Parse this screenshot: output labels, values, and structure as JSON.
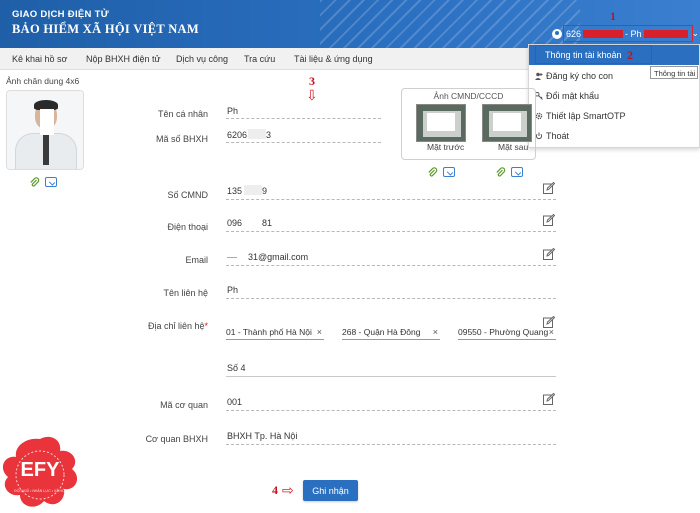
{
  "header": {
    "brand_top": "GIAO DỊCH ĐIỆN TỬ",
    "brand_main": "BẢO HIỂM XÃ HỘI VIỆT NAM",
    "user_prefix": "626",
    "user_suffix": "- Ph",
    "chevron": "⌄"
  },
  "annotations": {
    "step1": "1",
    "step2": "2",
    "step3": "⇩",
    "step3_num": "3",
    "step4": "4",
    "step4_arrow": "⇨"
  },
  "nav": {
    "items": [
      "Kê khai hồ sơ",
      "Nộp BHXH điện tử",
      "Dịch vụ công",
      "Tra cứu",
      "Tài liệu & ứng dụng"
    ]
  },
  "dropdown": {
    "active": "Thông tin tài khoản",
    "items": [
      {
        "label": "Đăng ký cho con",
        "icon": "user-add-icon"
      },
      {
        "label": "Đổi mật khẩu",
        "icon": "key-icon"
      },
      {
        "label": "Thiết lập SmartOTP",
        "icon": "gear-icon"
      },
      {
        "label": "Thoát",
        "icon": "power-icon"
      }
    ],
    "tooltip": "Thông tin tài"
  },
  "photo": {
    "label": "Ảnh chân dung 4x6"
  },
  "cmnd": {
    "title": "Ảnh CMND/CCCD",
    "front": "Mặt trước",
    "back": "Mặt sau"
  },
  "form": {
    "ten_ca_nhan": {
      "label": "Tên cá nhân",
      "value": "Ph"
    },
    "ma_so_bhxh": {
      "label": "Mã số BHXH",
      "value": "6206",
      "value_end": "3"
    },
    "so_cmnd": {
      "label": "Số CMND",
      "value": "135",
      "value_end": "9"
    },
    "dien_thoai": {
      "label": "Điện thoại",
      "value": "096",
      "value_end": "81"
    },
    "email": {
      "label": "Email",
      "value": "",
      "value_end": "31@gmail.com"
    },
    "ten_lien_he": {
      "label": "Tên liên hệ",
      "value": "Ph"
    },
    "dia_chi": {
      "label": "Địa chỉ liên hệ",
      "required": "*",
      "province": "01 - Thành phố Hà Nội",
      "district": "268 - Quận Hà Đông",
      "ward": "09550 - Phường Quang",
      "clear": "×",
      "street": "Số 4"
    },
    "ma_co_quan": {
      "label": "Mã cơ quan",
      "value": "001"
    },
    "co_quan_bhxh": {
      "label": "Cơ quan BHXH",
      "value": "BHXH Tp. Hà Nội"
    }
  },
  "submit_label": "Ghi nhận",
  "logo": {
    "text": "EFY",
    "ring": "ĐỘI NGŨ • NHÂN LỰC • XÃ HỘI"
  },
  "colors": {
    "primary": "#2a6fc0",
    "accent_red": "#e0202a",
    "logo_red": "#e8343a"
  }
}
